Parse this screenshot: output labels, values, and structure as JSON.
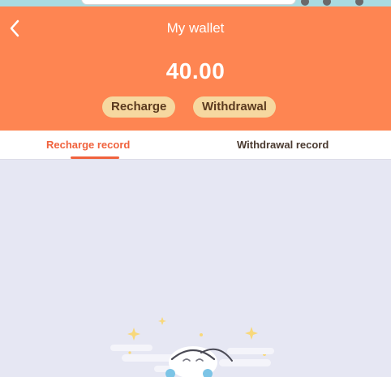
{
  "header": {
    "title": "My wallet",
    "balance": "40.00",
    "recharge_label": "Recharge",
    "withdrawal_label": "Withdrawal"
  },
  "tabs": [
    {
      "label": "Recharge record",
      "active": true
    },
    {
      "label": "Withdrawal record",
      "active": false
    }
  ],
  "colors": {
    "header_bg": "#fe8552",
    "button_bg": "#f6d8a0",
    "active_tab": "#f0623d",
    "page_bg": "#e6e7f3"
  },
  "icons": {
    "back": "chevron-left-icon",
    "empty_state": "empty-records-illustration"
  }
}
